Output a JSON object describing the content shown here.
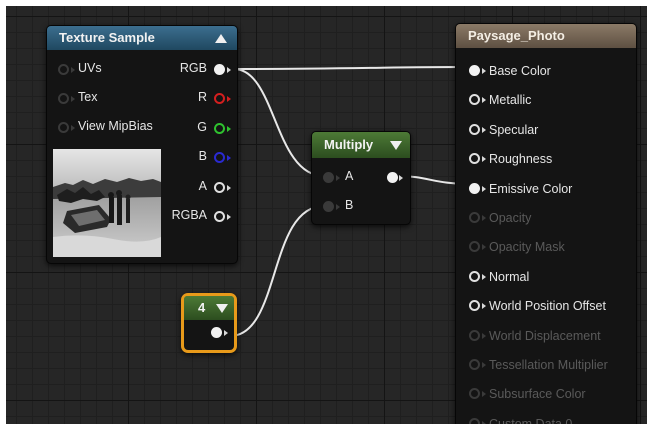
{
  "texture_node": {
    "title": "Texture Sample",
    "inputs": [
      "UVs",
      "Tex",
      "View MipBias"
    ],
    "outputs": [
      "RGB",
      "R",
      "G",
      "B",
      "A",
      "RGBA"
    ]
  },
  "multiply_node": {
    "title": "Multiply",
    "inputs": [
      "A",
      "B"
    ]
  },
  "constant_node": {
    "value": "4"
  },
  "material_node": {
    "title": "Paysage_Photo",
    "inputs": [
      {
        "label": "Base Color",
        "enabled": true,
        "connected": true
      },
      {
        "label": "Metallic",
        "enabled": true,
        "connected": false
      },
      {
        "label": "Specular",
        "enabled": true,
        "connected": false
      },
      {
        "label": "Roughness",
        "enabled": true,
        "connected": false
      },
      {
        "label": "Emissive Color",
        "enabled": true,
        "connected": true
      },
      {
        "label": "Opacity",
        "enabled": false,
        "connected": false
      },
      {
        "label": "Opacity Mask",
        "enabled": false,
        "connected": false
      },
      {
        "label": "Normal",
        "enabled": true,
        "connected": false
      },
      {
        "label": "World Position Offset",
        "enabled": true,
        "connected": false
      },
      {
        "label": "World Displacement",
        "enabled": false,
        "connected": false
      },
      {
        "label": "Tessellation Multiplier",
        "enabled": false,
        "connected": false
      },
      {
        "label": "Subsurface Color",
        "enabled": false,
        "connected": false
      },
      {
        "label": "Custom Data 0",
        "enabled": false,
        "connected": false
      }
    ]
  },
  "colors": {
    "canvas_bg": "#262626",
    "wire": "#e8e8e8",
    "texture_header": "#2f5d7a",
    "multiply_header": "#3f6a2c",
    "material_header": "#7a6a59",
    "selection_outline": "#e89a1a"
  }
}
